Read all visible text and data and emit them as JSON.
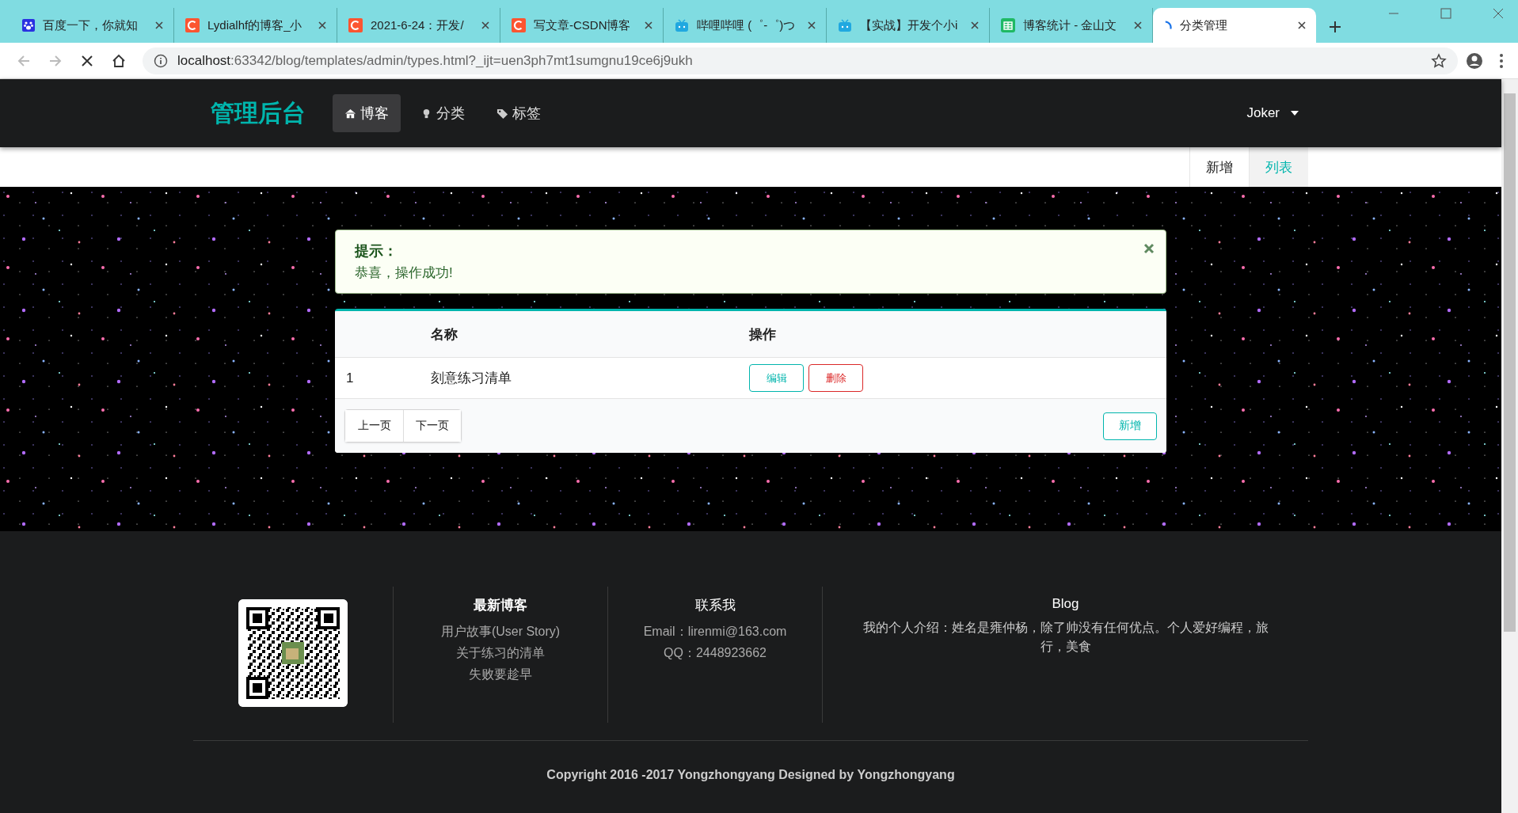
{
  "browser": {
    "tabs": [
      {
        "title": "百度一下，你就知",
        "kind": "paw",
        "selected": false
      },
      {
        "title": "Lydialhf的博客_小",
        "kind": "letter",
        "selected": false
      },
      {
        "title": "2021-6-24：开发/",
        "kind": "letter",
        "selected": false
      },
      {
        "title": "写文章-CSDN博客",
        "kind": "letter",
        "selected": false
      },
      {
        "title": "哔哩哔哩 (゜-゜)つ",
        "kind": "tv",
        "selected": false
      },
      {
        "title": "【实战】开发个小i",
        "kind": "tv",
        "selected": false
      },
      {
        "title": "博客统计 - 金山文",
        "kind": "sheet",
        "selected": false
      },
      {
        "title": "分类管理",
        "kind": "loading",
        "selected": true
      }
    ],
    "url_host": "localhost",
    "url_rest": ":63342/blog/templates/admin/types.html?_ijt=uen3ph7mt1sumgnu19ce6j9ukh"
  },
  "nav": {
    "brand": "管理后台",
    "items": [
      {
        "label": "博客",
        "kind": "home",
        "selected": true
      },
      {
        "label": "分类",
        "kind": "bulb",
        "selected": false
      },
      {
        "label": "标签",
        "kind": "tag",
        "selected": false
      }
    ],
    "user": "Joker"
  },
  "subnav": [
    {
      "label": "新增",
      "selected": false
    },
    {
      "label": "列表",
      "selected": true
    }
  ],
  "alert": {
    "title": "提示：",
    "message": "恭喜，操作成功!"
  },
  "table": {
    "columns": [
      "名称",
      "操作"
    ],
    "rows": [
      {
        "index": "1",
        "name": "刻意练习清单",
        "actions": [
          {
            "label": "编辑",
            "kind": "edit"
          },
          {
            "label": "删除",
            "kind": "delete"
          }
        ]
      }
    ],
    "pagination": [
      "上一页",
      "下一页"
    ],
    "add_button": "新增"
  },
  "footer": {
    "latest": {
      "title": "最新博客",
      "links": [
        "用户故事(User Story)",
        "关于练习的清单",
        "失败要趁早"
      ]
    },
    "contact": {
      "title": "联系我",
      "lines": [
        "Email：lirenmi@163.com",
        "QQ：2448923662"
      ]
    },
    "blog": {
      "title": "Blog",
      "text": "我的个人介绍：姓名是雍仲杨，除了帅没有任何优点。个人爱好编程，旅行，美食"
    },
    "copyright": "Copyright 2016 -2017 Yongzhongyang Designed by Yongzhongyang"
  }
}
